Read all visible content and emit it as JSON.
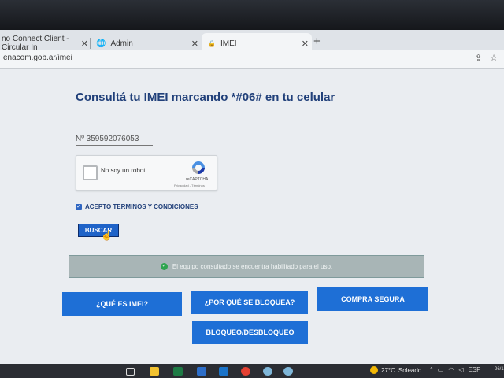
{
  "browser": {
    "tabs": [
      {
        "label": "no Connect Client - Circular In"
      },
      {
        "label": "Admin"
      },
      {
        "label": "IMEI"
      }
    ],
    "new_tab": "+",
    "url": "enacom.gob.ar/imei"
  },
  "page": {
    "title": "Consultá tu IMEI marcando *#06# en tu celular",
    "imei_value": "Nº 359592076053",
    "recaptcha": {
      "label": "No soy un robot",
      "brand": "reCAPTCHA",
      "links": "Privacidad - Términos"
    },
    "terms_label": "ACEPTO TERMINOS Y CONDICIONES",
    "terms_checked": true,
    "search_button": "BUSCAR",
    "status_message": "El equipo consultado se encuentra habilitado para el uso.",
    "buttons": [
      {
        "label": "¿QUÉ ES IMEI?"
      },
      {
        "label": "¿POR QUÉ SE BLOQUEA?"
      },
      {
        "label": "COMPRA SEGURA"
      },
      {
        "label": "BLOQUEO/DESBLOQUEO"
      }
    ],
    "colors": {
      "title": "#21407a",
      "button": "#1e6fd6",
      "status_bg": "#a8b5b6",
      "ok": "#2ea44f"
    }
  },
  "taskbar": {
    "weather_temp": "27°C",
    "weather_desc": "Soleado",
    "language": "ESP",
    "clock": "26/1"
  }
}
